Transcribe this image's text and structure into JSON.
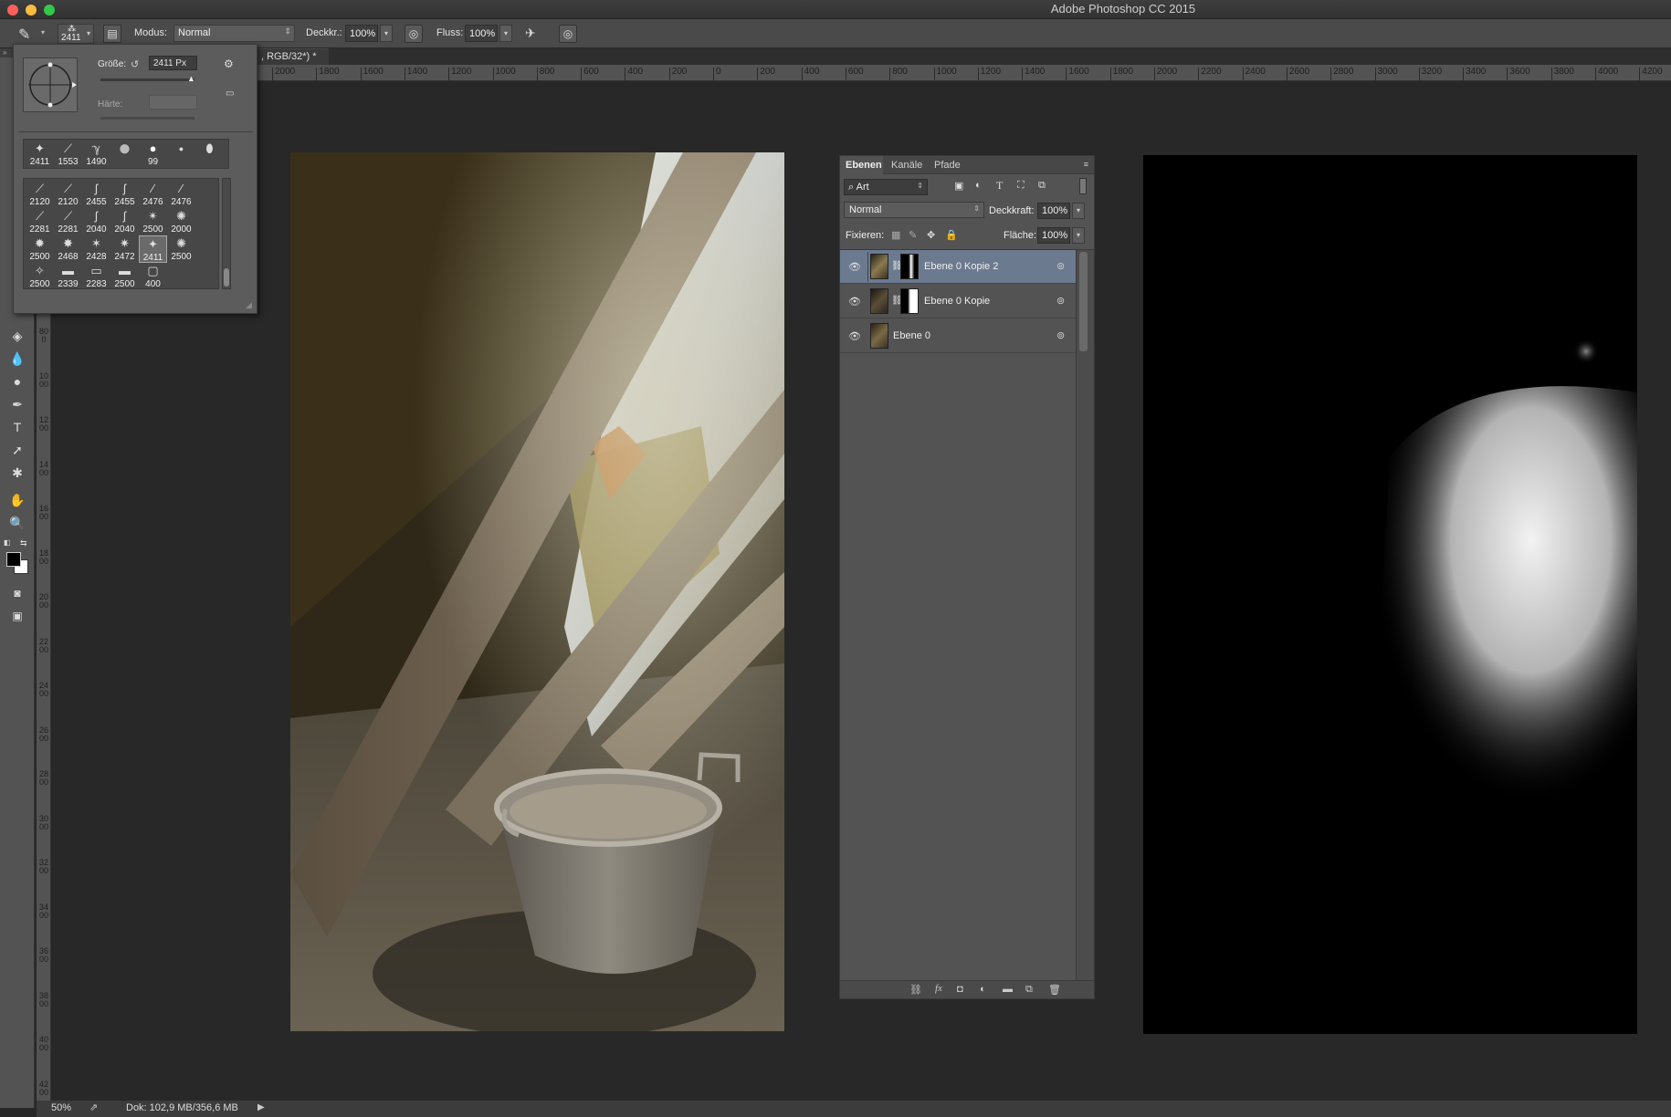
{
  "app": {
    "title": "Adobe Photoshop CC 2015",
    "traffic_colors": [
      "#fc605c",
      "#fdbc40",
      "#34c84a"
    ]
  },
  "options_bar": {
    "brush_size": "2411",
    "mode_label": "Modus:",
    "mode_value": "Normal",
    "opacity_label": "Deckkr.:",
    "opacity_value": "100%",
    "flow_label": "Fluss:",
    "flow_value": "100%"
  },
  "document_tab": {
    "title": ", RGB/32*) *"
  },
  "rulers": {
    "horizontal": [
      "2000",
      "1800",
      "1600",
      "1400",
      "1200",
      "1000",
      "800",
      "600",
      "400",
      "200",
      "0",
      "200",
      "400",
      "600",
      "800",
      "1000",
      "1200",
      "1400",
      "1600",
      "1800",
      "2000",
      "2200",
      "2400",
      "2600",
      "2800",
      "3000",
      "3200",
      "3400",
      "3600",
      "3800",
      "4000",
      "4200"
    ],
    "vertical": [
      "800",
      "1000",
      "1200",
      "1400",
      "1600",
      "1800",
      "2000",
      "2200",
      "2400",
      "2600",
      "2800",
      "3000",
      "3200",
      "3400",
      "3600",
      "3800",
      "4000",
      "4200"
    ]
  },
  "brush_popup": {
    "size_label": "Größe:",
    "size_value": "2411 Px",
    "hardness_label": "Härte:",
    "recent_brushes": [
      "2411",
      "1553",
      "1490",
      "",
      "99",
      ""
    ],
    "brushes": [
      "2120",
      "2120",
      "2455",
      "2455",
      "2476",
      "2476",
      "2281",
      "2281",
      "2040",
      "2040",
      "2500",
      "2000",
      "2500",
      "2468",
      "2428",
      "2472",
      "2411",
      "2500",
      "2500",
      "2339",
      "2283",
      "2500",
      "400"
    ]
  },
  "layers_panel": {
    "tabs": [
      "Ebenen",
      "Kanäle",
      "Pfade"
    ],
    "filter_value": "Art",
    "blend_mode": "Normal",
    "opacity_label": "Deckkraft:",
    "opacity_value": "100%",
    "lock_label": "Fixieren:",
    "fill_label": "Fläche:",
    "fill_value": "100%",
    "layers": [
      {
        "name": "Ebene 0 Kopie 2",
        "selected": true
      },
      {
        "name": "Ebene 0 Kopie",
        "selected": false
      },
      {
        "name": "Ebene 0",
        "selected": false
      }
    ]
  },
  "status_bar": {
    "zoom": "50%",
    "doc_info": "Dok: 102,9 MB/356,6 MB"
  }
}
